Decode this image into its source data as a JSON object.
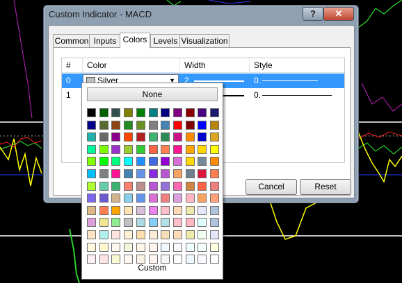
{
  "window": {
    "title": "Custom Indicator - MACD",
    "help_label": "?",
    "close_label": "✕"
  },
  "tabs": [
    {
      "label": "Common",
      "active": false
    },
    {
      "label": "Inputs",
      "active": false
    },
    {
      "label": "Colors",
      "active": true
    },
    {
      "label": "Levels",
      "active": false
    },
    {
      "label": "Visualization",
      "active": false
    }
  ],
  "table": {
    "columns": {
      "num": "#",
      "color": "Color",
      "width": "Width",
      "style": "Style"
    },
    "rows": [
      {
        "num": "0",
        "color": "Silver",
        "color_hex": "#c0c0c0",
        "width": "2.",
        "style": "0.",
        "line_color": "#ffffff"
      },
      {
        "num": "1",
        "color": "",
        "color_hex": "#ffffff",
        "width": "",
        "style": "0.",
        "line_color": "#000000"
      }
    ]
  },
  "buttons": {
    "cancel": "Cancel",
    "reset": "Reset"
  },
  "popup": {
    "none_label": "None",
    "custom_label": "Custom",
    "palette": [
      [
        "#000000",
        "#006400",
        "#2f4f4f",
        "#808000",
        "#008000",
        "#008080",
        "#000080",
        "#800080",
        "#8b0000",
        "#4b0082",
        "#191970"
      ],
      [
        "#00008b",
        "#556b2f",
        "#8b4513",
        "#228b22",
        "#6b8e23",
        "#808080",
        "#4682b4",
        "#ff0000",
        "#800000",
        "#0000ff",
        "#b8860b"
      ],
      [
        "#20b2aa",
        "#696969",
        "#8b008b",
        "#ff4500",
        "#b22222",
        "#3cb371",
        "#2e8b57",
        "#c71585",
        "#ff8c00",
        "#0000cd",
        "#daa520"
      ],
      [
        "#00fa9a",
        "#7cfc00",
        "#9932cc",
        "#9acd32",
        "#32cd32",
        "#ff6347",
        "#ff7f50",
        "#ff1493",
        "#ffa500",
        "#ffd700",
        "#ffff00"
      ],
      [
        "#7fff00",
        "#00ff00",
        "#00ff7f",
        "#00ffff",
        "#1e90ff",
        "#4169e1",
        "#9400d3",
        "#da70d6",
        "#ffd700",
        "#778899",
        "#ff8c00"
      ],
      [
        "#00bfff",
        "#808080",
        "#ff1493",
        "#4682b4",
        "#6495ed",
        "#8a2be2",
        "#ba55d3",
        "#f4a460",
        "#708090",
        "#dc143c",
        "#ff7f50"
      ],
      [
        "#adff2f",
        "#66cdaa",
        "#3cb371",
        "#fa8072",
        "#bc8f8f",
        "#ba55d3",
        "#9370db",
        "#ff69b4",
        "#cd853f",
        "#ff6347",
        "#f08080"
      ],
      [
        "#7b68ee",
        "#6a5acd",
        "#d2b48c",
        "#87ceeb",
        "#6495ed",
        "#da70d6",
        "#f08080",
        "#dda0dd",
        "#ffb6c1",
        "#f4a460",
        "#ffa07a"
      ],
      [
        "#deb887",
        "#ff7f50",
        "#ffa500",
        "#ffe4b5",
        "#d8bfd8",
        "#ee82ee",
        "#ffc0cb",
        "#ffdab9",
        "#eee8aa",
        "#e6e6fa",
        "#b0c4de"
      ],
      [
        "#dda0dd",
        "#f0e68c",
        "#90ee90",
        "#c0c0c0",
        "#add8e6",
        "#87cefa",
        "#b0e0e6",
        "#ffc0cb",
        "#ffb6c1",
        "#e0ffff",
        "#b0c4de"
      ],
      [
        "#ffe4c4",
        "#afeeee",
        "#ffe4e1",
        "#ffefd5",
        "#ffdead",
        "#faebd7",
        "#f5deb3",
        "#ffdab9",
        "#eee8aa",
        "#f0fff0",
        "#e6e6fa"
      ],
      [
        "#fff8dc",
        "#fffacd",
        "#fffaf0",
        "#f5f5dc",
        "#fdf5e6",
        "#fff5ee",
        "#f0f8ff",
        "#f8f8ff",
        "#f0ffff",
        "#f5fffa",
        "#ffffe0"
      ],
      [
        "#fff0f5",
        "#ffe4e1",
        "#fafad2",
        "#fffaf0",
        "#faf0e6",
        "#fff5ee",
        "#f5f5f5",
        "#ffffff",
        "#f0f8ff",
        "#f8f8ff",
        "#ffffff"
      ]
    ]
  }
}
